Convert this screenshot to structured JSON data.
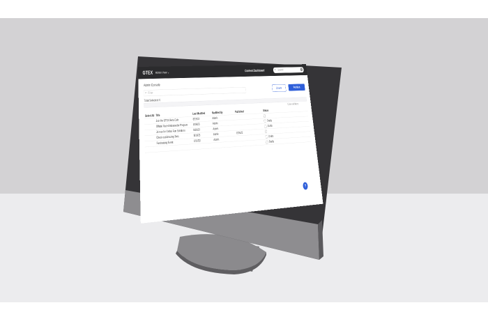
{
  "app": {
    "brand": "GTEX",
    "admin_menu": "Admin View ⌄",
    "nav_link": "Content Dashboard",
    "search_placeholder": "Search"
  },
  "page": {
    "title": "Admin Console",
    "filter_placeholder": "Filter",
    "secondary_button": "Delete",
    "primary_button": "Publish",
    "selection_text": "Total Selected: 0",
    "clear_filters": "Clear all filters"
  },
  "table": {
    "headers": [
      "Select All",
      "Title",
      "Last Modified",
      "Modified By",
      "Published",
      "Status"
    ],
    "rows": [
      {
        "select": "",
        "title": "Join the GTEX Beta Club",
        "modified": "8/19/23",
        "by": "Admin",
        "published": "",
        "status": ""
      },
      {
        "select": "",
        "title": "Official Race Ambassador Program",
        "modified": "8/19/23",
        "by": "Admin",
        "published": "",
        "status": "Drafts"
      },
      {
        "select": "",
        "title": "Join us for Global Run Solutions",
        "modified": "8/16/23",
        "by": "Admin",
        "published": "",
        "status": "Drafts"
      },
      {
        "select": "",
        "title": "Check out Amazing Tees",
        "modified": "8/16/23",
        "by": "Admin",
        "published": "8/16/23",
        "status": ""
      },
      {
        "select": "",
        "title": "Fundraising Event",
        "modified": "8/16/23",
        "by": "Admin",
        "published": "",
        "status": "Drafts"
      },
      {
        "select": "",
        "title": "",
        "modified": "",
        "by": "",
        "published": "",
        "status": "Drafts"
      }
    ]
  },
  "help_label": "?"
}
